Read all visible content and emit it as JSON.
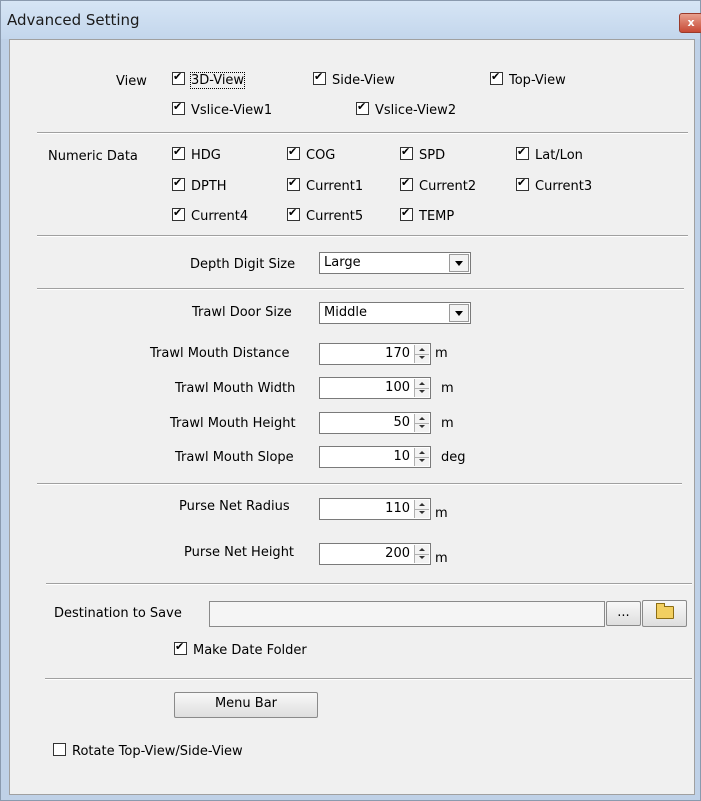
{
  "window": {
    "title": "Advanced Setting",
    "close_glyph": "x"
  },
  "view": {
    "label": "View",
    "items": [
      {
        "label": "3D-View",
        "checked": true
      },
      {
        "label": "Side-View",
        "checked": true
      },
      {
        "label": "Top-View",
        "checked": true
      },
      {
        "label": "Vslice-View1",
        "checked": true
      },
      {
        "label": "Vslice-View2",
        "checked": true
      }
    ]
  },
  "numeric": {
    "label": "Numeric Data",
    "items": [
      {
        "label": "HDG",
        "checked": true
      },
      {
        "label": "COG",
        "checked": true
      },
      {
        "label": "SPD",
        "checked": true
      },
      {
        "label": "Lat/Lon",
        "checked": true
      },
      {
        "label": "DPTH",
        "checked": true
      },
      {
        "label": "Current1",
        "checked": true
      },
      {
        "label": "Current2",
        "checked": true
      },
      {
        "label": "Current3",
        "checked": true
      },
      {
        "label": "Current4",
        "checked": true
      },
      {
        "label": "Current5",
        "checked": true
      },
      {
        "label": "TEMP",
        "checked": true
      }
    ]
  },
  "depth_digit": {
    "label": "Depth Digit Size",
    "value": "Large"
  },
  "trawl": {
    "door_size": {
      "label": "Trawl Door Size",
      "value": "Middle"
    },
    "fields": [
      {
        "label": "Trawl Mouth Distance",
        "value": "170",
        "unit": "m"
      },
      {
        "label": "Trawl Mouth Width",
        "value": "100",
        "unit": "m"
      },
      {
        "label": "Trawl Mouth Height",
        "value": "50",
        "unit": "m"
      },
      {
        "label": "Trawl Mouth Slope",
        "value": "10",
        "unit": "deg"
      }
    ]
  },
  "purse": {
    "fields": [
      {
        "label": "Purse Net Radius",
        "value": "110",
        "unit": "m"
      },
      {
        "label": "Purse Net Height",
        "value": "200",
        "unit": "m"
      }
    ]
  },
  "destination": {
    "label": "Destination to Save",
    "value": "",
    "browse_label": "...",
    "make_date_folder": {
      "label": "Make Date Folder",
      "checked": true
    }
  },
  "menu_bar_button": "Menu Bar",
  "rotate": {
    "label": "Rotate Top-View/Side-View",
    "checked": false
  }
}
